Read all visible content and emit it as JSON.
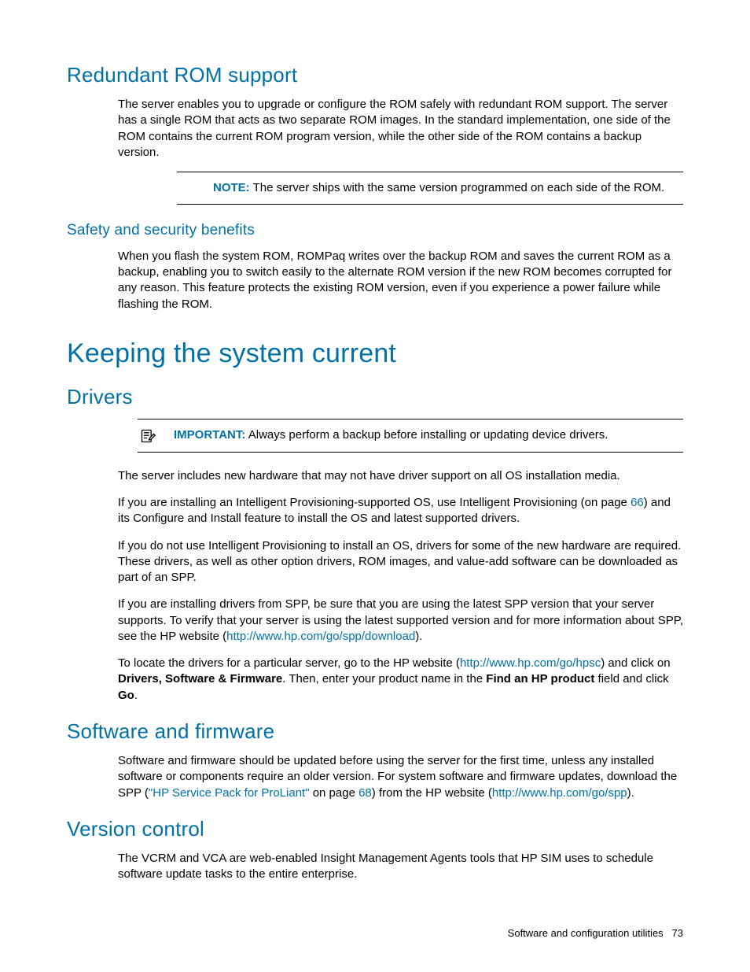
{
  "sections": {
    "redundant_rom": {
      "heading": "Redundant ROM support",
      "p1": "The server enables you to upgrade or configure the ROM safely with redundant ROM support. The server has a single ROM that acts as two separate ROM images. In the standard implementation, one side of the ROM contains the current ROM program version, while the other side of the ROM contains a backup version.",
      "note_label": "NOTE:",
      "note_text": "The server ships with the same version programmed on each side of the ROM."
    },
    "safety": {
      "heading": "Safety and security benefits",
      "p1": "When you flash the system ROM, ROMPaq writes over the backup ROM and saves the current ROM as a backup, enabling you to switch easily to the alternate ROM version if the new ROM becomes corrupted for any reason. This feature protects the existing ROM version, even if you experience a power failure while flashing the ROM."
    },
    "keeping": {
      "heading": "Keeping the system current"
    },
    "drivers": {
      "heading": "Drivers",
      "important_label": "IMPORTANT:",
      "important_text": "Always perform a backup before installing or updating device drivers.",
      "p1": "The server includes new hardware that may not have driver support on all OS installation media.",
      "p2_a": "If you are installing an Intelligent Provisioning-supported OS, use Intelligent Provisioning (on page ",
      "p2_link": "66",
      "p2_b": ") and its Configure and Install feature to install the OS and latest supported drivers.",
      "p3": "If you do not use Intelligent Provisioning to install an OS, drivers for some of the new hardware are required. These drivers, as well as other option drivers, ROM images, and value-add software can be downloaded as part of an SPP.",
      "p4_a": "If you are installing drivers from SPP, be sure that you are using the latest SPP version that your server supports. To verify that your server is using the latest supported version and for more information about SPP, see the HP website (",
      "p4_link": "http://www.hp.com/go/spp/download",
      "p4_b": ").",
      "p5_a": "To locate the drivers for a particular server, go to the HP website (",
      "p5_link": "http://www.hp.com/go/hpsc",
      "p5_b": ") and click on ",
      "p5_bold1": "Drivers, Software & Firmware",
      "p5_c": ". Then, enter your product name in the ",
      "p5_bold2": "Find an HP product",
      "p5_d": " field and click ",
      "p5_bold3": "Go",
      "p5_e": "."
    },
    "software_firmware": {
      "heading": "Software and firmware",
      "p1_a": "Software and firmware should be updated before using the server for the first time, unless any installed software or components require an older version. For system software and firmware updates, download the SPP (",
      "p1_link1": "\"HP Service Pack for ProLiant\"",
      "p1_b": " on page ",
      "p1_link2": "68",
      "p1_c": ") from the HP website (",
      "p1_link3": "http://www.hp.com/go/spp",
      "p1_d": ")."
    },
    "version_control": {
      "heading": "Version control",
      "p1": "The VCRM and VCA are web-enabled Insight Management Agents tools that HP SIM uses to schedule software update tasks to the entire enterprise."
    }
  },
  "footer": {
    "text": "Software and configuration utilities",
    "page": "73"
  }
}
